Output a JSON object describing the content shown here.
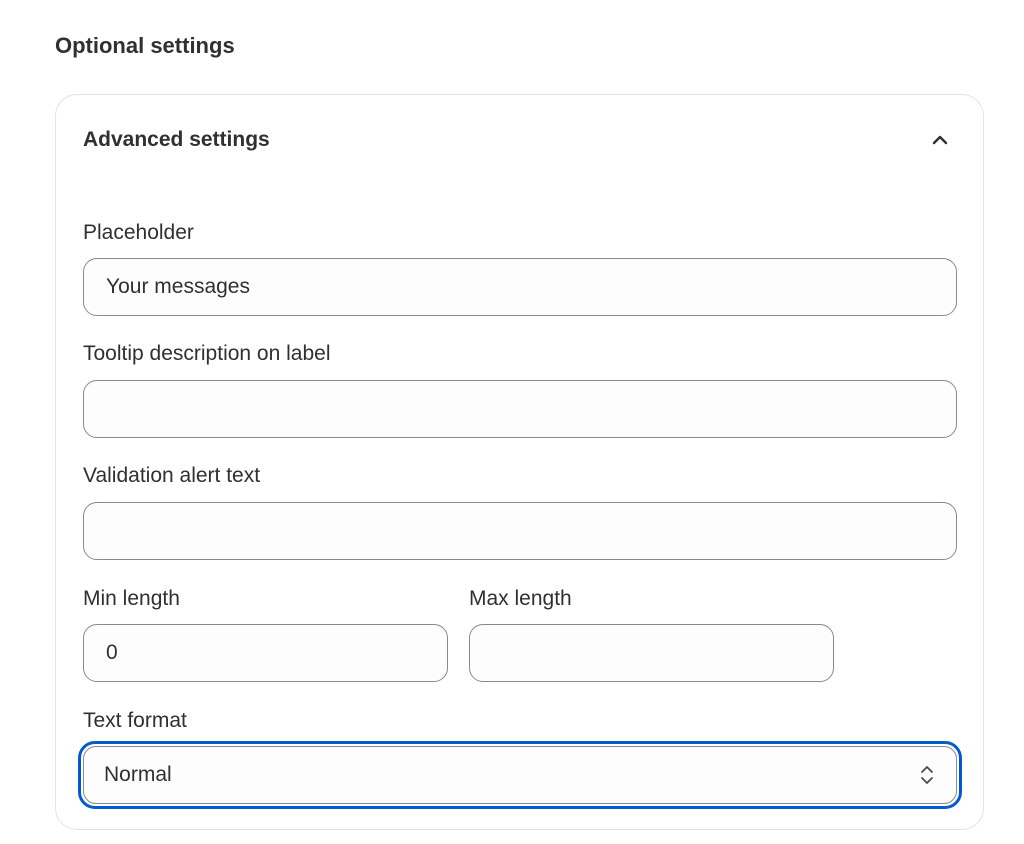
{
  "section": {
    "title": "Optional settings"
  },
  "advanced": {
    "title": "Advanced settings",
    "collapse_icon": "chevron-up-icon"
  },
  "fields": {
    "placeholder": {
      "label": "Placeholder",
      "value": "Your messages"
    },
    "tooltip": {
      "label": "Tooltip description on label",
      "value": ""
    },
    "validation": {
      "label": "Validation alert text",
      "value": ""
    },
    "min_length": {
      "label": "Min length",
      "value": "0"
    },
    "max_length": {
      "label": "Max length",
      "value": ""
    },
    "text_format": {
      "label": "Text format",
      "selected": "Normal",
      "icon": "select-arrows-icon"
    }
  },
  "colors": {
    "focus_ring": "#005bd3",
    "field_border": "#8a8a8a",
    "card_border": "#e3e3e3",
    "text": "#303030"
  }
}
